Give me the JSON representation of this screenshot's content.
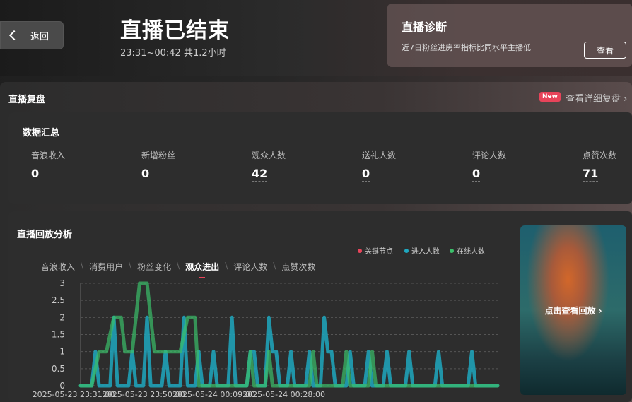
{
  "header": {
    "back_label": "返回",
    "title": "直播已结束",
    "subtitle": "23:31~00:42 共1.2小时"
  },
  "diagnosis": {
    "title": "直播诊断",
    "desc": "近7日粉丝进房率指标比同水平主播低",
    "button": "查看"
  },
  "review": {
    "title": "直播复盘",
    "badge": "New",
    "detail_link": "查看详细复盘 ›"
  },
  "summary": {
    "title": "数据汇总",
    "metrics": [
      {
        "label": "音浪收入",
        "value": "0"
      },
      {
        "label": "新增粉丝",
        "value": "0"
      },
      {
        "label": "观众人数",
        "value": "42"
      },
      {
        "label": "送礼人数",
        "value": "0"
      },
      {
        "label": "评论人数",
        "value": "0"
      },
      {
        "label": "点赞次数",
        "value": "71"
      }
    ]
  },
  "replay": {
    "title": "直播回放分析",
    "legend": [
      {
        "label": "关键节点",
        "color": "#e8445a"
      },
      {
        "label": "进入人数",
        "color": "#1fa8c0"
      },
      {
        "label": "在线人数",
        "color": "#3bbf6a"
      }
    ],
    "tabs": [
      "音浪收入",
      "消费用户",
      "粉丝变化",
      "观众进出",
      "评论人数",
      "点赞次数"
    ],
    "active_tab": 3,
    "video_label": "点击查看回放 ›"
  },
  "chart_data": {
    "type": "line",
    "ylim": [
      0,
      3
    ],
    "yticks": [
      "0",
      "0.5",
      "1",
      "1.5",
      "2",
      "2.5",
      "3"
    ],
    "xticks": [
      "2025-05-23 23:31:00",
      "2025-05-23 23:50:00",
      "2025-05-24 00:09:00",
      "2025-05-24 00:28:00"
    ],
    "grid": true,
    "series": [
      {
        "name": "进入人数",
        "color": "#1fa8c0",
        "points": [
          [
            0,
            0
          ],
          [
            3,
            0
          ],
          [
            4,
            1
          ],
          [
            5,
            0
          ],
          [
            8,
            0
          ],
          [
            9,
            2
          ],
          [
            10,
            0
          ],
          [
            13,
            0
          ],
          [
            14,
            1
          ],
          [
            15,
            0
          ],
          [
            17,
            0
          ],
          [
            18,
            2
          ],
          [
            19,
            0
          ],
          [
            22,
            0
          ],
          [
            23,
            1
          ],
          [
            24,
            0
          ],
          [
            27,
            0
          ],
          [
            28,
            2
          ],
          [
            29,
            0
          ],
          [
            31,
            0
          ],
          [
            32,
            1
          ],
          [
            33,
            0
          ],
          [
            35,
            0
          ],
          [
            36,
            1
          ],
          [
            37,
            0
          ],
          [
            40,
            0
          ],
          [
            41,
            2
          ],
          [
            42,
            0
          ],
          [
            45,
            0
          ],
          [
            46,
            1
          ],
          [
            47,
            1
          ],
          [
            48,
            0
          ],
          [
            50,
            0
          ],
          [
            51,
            2
          ],
          [
            52,
            1
          ],
          [
            53,
            1
          ],
          [
            54,
            0
          ],
          [
            56,
            0
          ],
          [
            57,
            1
          ],
          [
            58,
            0
          ],
          [
            61,
            0
          ],
          [
            62,
            1
          ],
          [
            63,
            0
          ],
          [
            65,
            0
          ],
          [
            66,
            2
          ],
          [
            67,
            1
          ],
          [
            68,
            1
          ],
          [
            69,
            0
          ],
          [
            72,
            0
          ],
          [
            73,
            1
          ],
          [
            74,
            0
          ],
          [
            77,
            0
          ],
          [
            78,
            1
          ],
          [
            79,
            0
          ],
          [
            82,
            0
          ],
          [
            83,
            1
          ],
          [
            84,
            0
          ],
          [
            88,
            0
          ],
          [
            89,
            1
          ],
          [
            90,
            0
          ],
          [
            96,
            0
          ],
          [
            97,
            1
          ],
          [
            98,
            0
          ],
          [
            105,
            0
          ],
          [
            106,
            1
          ],
          [
            107,
            0
          ],
          [
            113,
            0
          ]
        ]
      },
      {
        "name": "在线人数",
        "color": "#3bbf6a",
        "points": [
          [
            0,
            0
          ],
          [
            3,
            0
          ],
          [
            5,
            1
          ],
          [
            7,
            1
          ],
          [
            9,
            2
          ],
          [
            11,
            2
          ],
          [
            12,
            1
          ],
          [
            14,
            1
          ],
          [
            16,
            3
          ],
          [
            18,
            3
          ],
          [
            20,
            1
          ],
          [
            23,
            1
          ],
          [
            25,
            1
          ],
          [
            27,
            1
          ],
          [
            29,
            2
          ],
          [
            31,
            2
          ],
          [
            32,
            0
          ],
          [
            40,
            0
          ],
          [
            45,
            0
          ],
          [
            46,
            1
          ],
          [
            47,
            0
          ],
          [
            50,
            0
          ],
          [
            51,
            1
          ],
          [
            52,
            0
          ],
          [
            62,
            0
          ],
          [
            63,
            1
          ],
          [
            64,
            0
          ],
          [
            71,
            0
          ],
          [
            72,
            1
          ],
          [
            73,
            0
          ],
          [
            78,
            0
          ],
          [
            79,
            1
          ],
          [
            80,
            0
          ],
          [
            84,
            0
          ],
          [
            85,
            0
          ],
          [
            113,
            0
          ]
        ]
      }
    ]
  }
}
